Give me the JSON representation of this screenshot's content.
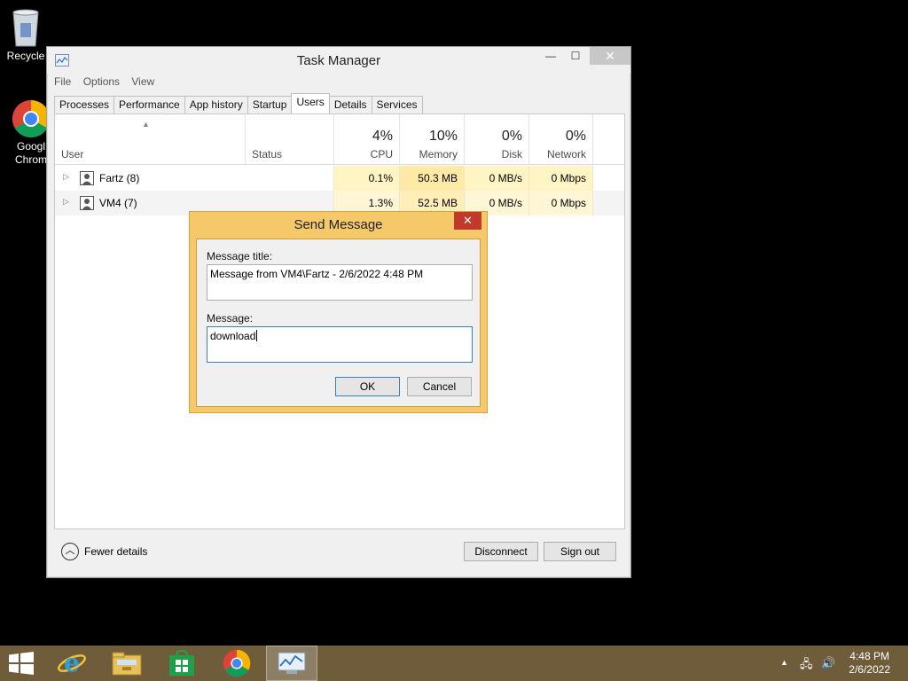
{
  "desktop": {
    "icons": [
      {
        "label": "Recycle"
      },
      {
        "label": "Googl\nChrom"
      }
    ]
  },
  "task_manager": {
    "title": "Task Manager",
    "caption": {
      "minimize": "—",
      "maximize": "☐",
      "close": "✕"
    },
    "menu": [
      "File",
      "Options",
      "View"
    ],
    "tabs": [
      "Processes",
      "Performance",
      "App history",
      "Startup",
      "Users",
      "Details",
      "Services"
    ],
    "active_tab": "Users",
    "columns": {
      "user": "User",
      "status": "Status",
      "cpu": {
        "pct": "4%",
        "name": "CPU"
      },
      "memory": {
        "pct": "10%",
        "name": "Memory"
      },
      "disk": {
        "pct": "0%",
        "name": "Disk"
      },
      "network": {
        "pct": "0%",
        "name": "Network"
      }
    },
    "rows": [
      {
        "user": "Fartz (8)",
        "status": "",
        "cpu": "0.1%",
        "memory": "50.3 MB",
        "disk": "0 MB/s",
        "network": "0 Mbps"
      },
      {
        "user": "VM4 (7)",
        "status": "",
        "cpu": "1.3%",
        "memory": "52.5 MB",
        "disk": "0 MB/s",
        "network": "0 Mbps"
      }
    ],
    "footer": {
      "fewer_details": "Fewer details",
      "disconnect": "Disconnect",
      "sign_out": "Sign out"
    }
  },
  "send_message": {
    "title": "Send Message",
    "close": "✕",
    "title_label": "Message title:",
    "title_value": "Message from VM4\\Fartz - 2/6/2022 4:48 PM",
    "message_label": "Message:",
    "message_value": "download",
    "ok": "OK",
    "cancel": "Cancel"
  },
  "taskbar": {
    "items": [
      "start-icon",
      "internet-explorer-icon",
      "file-explorer-icon",
      "store-icon",
      "chrome-icon",
      "task-manager-icon"
    ],
    "clock": {
      "time": "4:48 PM",
      "date": "2/6/2022"
    }
  },
  "colors": {
    "taskbar": "#6e5c3a",
    "dialog_frame": "#f5c86a",
    "cpu_highlight": "#fff4c4",
    "memory_highlight": "#ffe9a6",
    "close_red": "#c0392b"
  }
}
